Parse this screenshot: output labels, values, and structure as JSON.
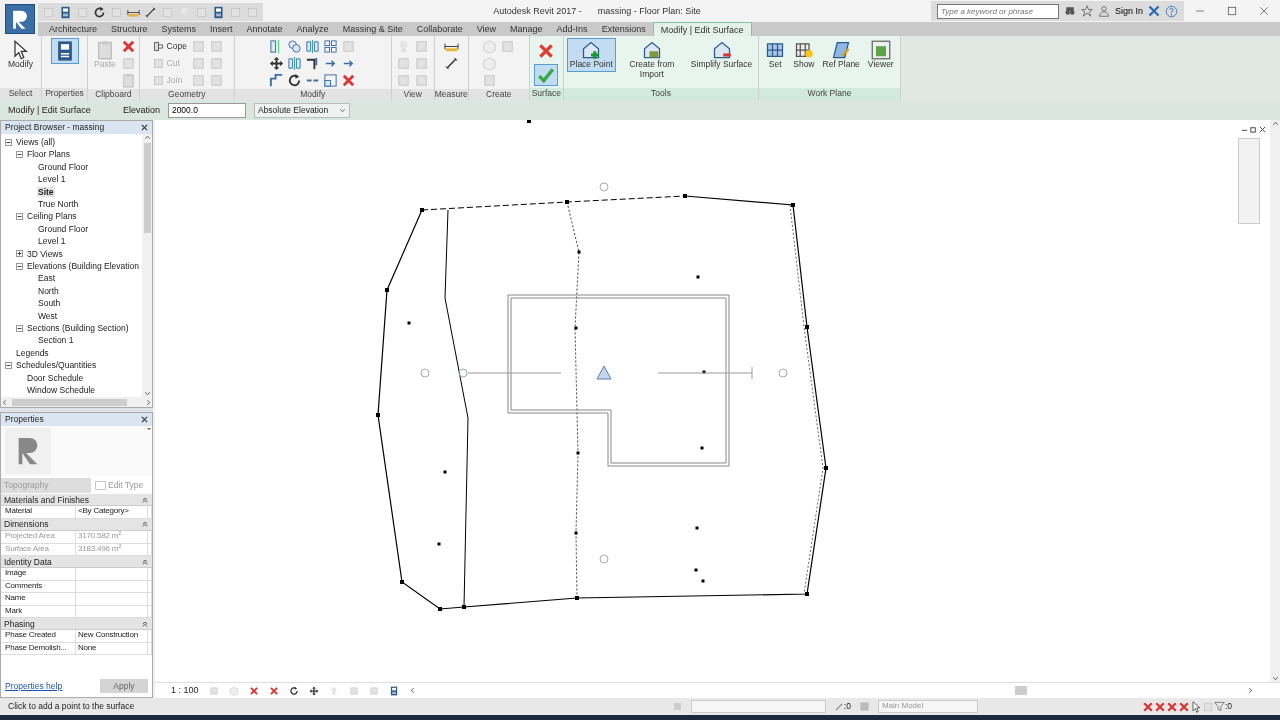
{
  "window": {
    "title": "Autodesk Revit 2017 -",
    "document": "massing - Floor Plan: Site"
  },
  "search": {
    "placeholder": "Type a keyword or phrase"
  },
  "sign_in": "Sign In",
  "tabs": [
    {
      "label": "Architecture",
      "selected": false
    },
    {
      "label": "Structure",
      "selected": false
    },
    {
      "label": "Systems",
      "selected": false
    },
    {
      "label": "Insert",
      "selected": false
    },
    {
      "label": "Annotate",
      "selected": false
    },
    {
      "label": "Analyze",
      "selected": false
    },
    {
      "label": "Massing & Site",
      "selected": false
    },
    {
      "label": "Collaborate",
      "selected": false
    },
    {
      "label": "View",
      "selected": false
    },
    {
      "label": "Manage",
      "selected": false
    },
    {
      "label": "Add-Ins",
      "selected": false
    },
    {
      "label": "Extensions",
      "selected": false
    },
    {
      "label": "Modify | Edit Surface",
      "selected": true
    }
  ],
  "ribbon_panels": [
    {
      "title": "Select",
      "tools": [
        {
          "kind": "large",
          "label": "Modify",
          "selected": false,
          "disabled": false
        }
      ]
    },
    {
      "title": "Properties",
      "tools": [
        {
          "kind": "large",
          "selected": true
        }
      ]
    },
    {
      "title": "Clipboard",
      "tools": [
        {
          "kind": "large",
          "label": "Paste",
          "selected": false,
          "disabled": true
        }
      ]
    },
    {
      "title": "Geometry",
      "tools": [
        {
          "kind": "small",
          "label": "Cope",
          "disabled": false
        },
        {
          "kind": "small",
          "label": "Cut",
          "disabled": true
        },
        {
          "kind": "small",
          "label": "Join",
          "disabled": true
        }
      ]
    },
    {
      "title": "Modify"
    },
    {
      "title": "View"
    },
    {
      "title": "Measure"
    },
    {
      "title": "Create"
    },
    {
      "title": "Surface",
      "tools": [
        {
          "kind": "cancel",
          "selected": false
        },
        {
          "kind": "finish",
          "selected": true
        }
      ]
    },
    {
      "title": "Tools",
      "tools": [
        {
          "kind": "large",
          "label": "Place Point",
          "selected": true,
          "disabled": false
        },
        {
          "kind": "large",
          "label": "Create from Import",
          "selected": false,
          "disabled": false
        },
        {
          "kind": "large",
          "label": "Simplify Surface",
          "selected": false,
          "disabled": false
        }
      ]
    },
    {
      "title": "Work Plane",
      "tools": [
        {
          "kind": "large",
          "label": "Set",
          "selected": false,
          "disabled": false
        },
        {
          "kind": "large",
          "label": "Show",
          "selected": false,
          "disabled": false
        },
        {
          "kind": "large",
          "label": "Ref Plane",
          "selected": false,
          "disabled": false
        },
        {
          "kind": "large",
          "label": "Viewer",
          "selected": false,
          "disabled": false
        }
      ]
    }
  ],
  "options_bar": {
    "context": "Modify | Edit Surface",
    "elevation_label": "Elevation",
    "elevation": "2000.0",
    "elevation_mode": "Absolute Elevation"
  },
  "project_browser": {
    "title": "Project Browser - massing",
    "items": [
      {
        "label": "Views (all)",
        "expanded": true,
        "selected": false,
        "children": [
          {
            "label": "Floor Plans",
            "expanded": true,
            "selected": false,
            "children": [
              {
                "label": "Ground Floor",
                "selected": false
              },
              {
                "label": "Level 1",
                "selected": false
              },
              {
                "label": "Site",
                "selected": true
              },
              {
                "label": "True North",
                "selected": false
              }
            ]
          },
          {
            "label": "Ceiling Plans",
            "expanded": true,
            "selected": false,
            "children": [
              {
                "label": "Ground Floor",
                "selected": false
              },
              {
                "label": "Level 1",
                "selected": false
              }
            ]
          },
          {
            "label": "3D Views",
            "expanded": false,
            "selected": false
          },
          {
            "label": "Elevations (Building Elevation",
            "expanded": true,
            "selected": false,
            "children": [
              {
                "label": "East",
                "selected": false
              },
              {
                "label": "North",
                "selected": false
              },
              {
                "label": "South",
                "selected": false
              },
              {
                "label": "West",
                "selected": false
              }
            ]
          },
          {
            "label": "Sections (Building Section)",
            "expanded": true,
            "selected": false,
            "children": [
              {
                "label": "Section 1",
                "selected": false
              }
            ]
          }
        ]
      },
      {
        "label": "Legends",
        "selected": false
      },
      {
        "label": "Schedules/Quantities",
        "expanded": true,
        "selected": false,
        "children": [
          {
            "label": "Door Schedule",
            "selected": false
          },
          {
            "label": "Window Schedule",
            "selected": false
          }
        ]
      }
    ]
  },
  "properties": {
    "title": "Properties",
    "type": "Topography",
    "edit_type": "Edit Type",
    "groups": [
      {
        "title": "Materials and Finishes",
        "rows": [
          {
            "name": "Material",
            "value": "<By Category>",
            "disabled": false
          }
        ]
      },
      {
        "title": "Dimensions",
        "rows": [
          {
            "name": "Projected Area",
            "value": "3170.582 m$^{2}$",
            "disabled": true
          },
          {
            "name": "Surface Area",
            "value": "3183.496 m$^{2}$",
            "disabled": true
          }
        ]
      },
      {
        "title": "Identity Data",
        "rows": [
          {
            "name": "Image",
            "disabled": false
          },
          {
            "name": "Comments",
            "disabled": false
          },
          {
            "name": "Name",
            "disabled": false
          },
          {
            "name": "Mark",
            "disabled": false
          }
        ]
      },
      {
        "title": "Phasing",
        "rows": [
          {
            "name": "Phase Created",
            "value": "New Construction",
            "disabled": false
          },
          {
            "name": "Phase Demolish...",
            "value": "None",
            "disabled": false
          }
        ]
      }
    ],
    "help": "Properties help",
    "apply": "Apply"
  },
  "view_bar": {
    "scale": "1 : 100"
  },
  "status_bar": {
    "message": "Click to add a point to the surface",
    "selection_count": ":0",
    "model": "Main Model",
    "filter_count": ":0"
  }
}
